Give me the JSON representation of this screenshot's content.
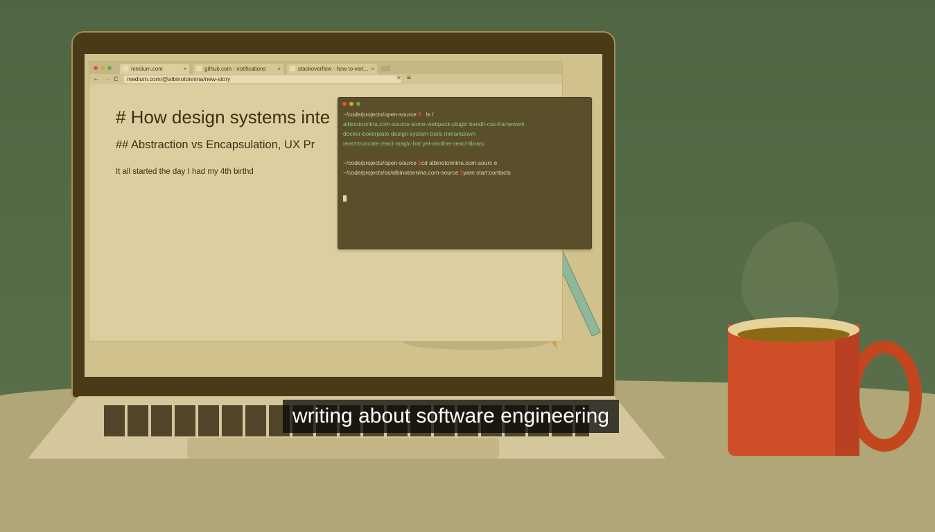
{
  "browser": {
    "tabs": [
      {
        "label": "medium.com",
        "close": "×"
      },
      {
        "label": "github.com - notifications",
        "close": "×"
      },
      {
        "label": "stackoverflow - how to vert...",
        "close": "×"
      }
    ],
    "nav": {
      "back": "←",
      "forward": "→",
      "reload": "C"
    },
    "url": "medium.com/@albinotonnina/new-story",
    "star": "★",
    "menu": "≡"
  },
  "article": {
    "heading": "# How design systems inte",
    "subheading": "## Abstraction vs Encapsulation, UX Pr",
    "paragraph": "It all started the day I had my 4th birthd"
  },
  "terminal": {
    "line1_path": "~/code/projects/open-source",
    "line1_prompt": "$",
    "line1_cmd": "ls /",
    "ls_output": [
      "albinotonnina.com-source some-webpack-plugin bandit-css-framework",
      "docker-boilerplate design-system-tools mmarkdown",
      "react-truncate react-magic-hat yet-another-react-library"
    ],
    "line2_path": "~/code/projects/open-source",
    "line2_prompt": "$",
    "line2_cmd": "cd albinotonnina.com-sourc e",
    "line3_path": "~/code/projects/os/albinotonnina.com-source",
    "line3_prompt": "$",
    "line3_cmd": "yarn start:contacts"
  },
  "caption": "writing about software engineering",
  "colors": {
    "wall": "#536a47",
    "mug": "#d04e27",
    "terminal_bg": "#5b4e2b",
    "prompt": "#d55a32",
    "output": "#8fc87a"
  }
}
